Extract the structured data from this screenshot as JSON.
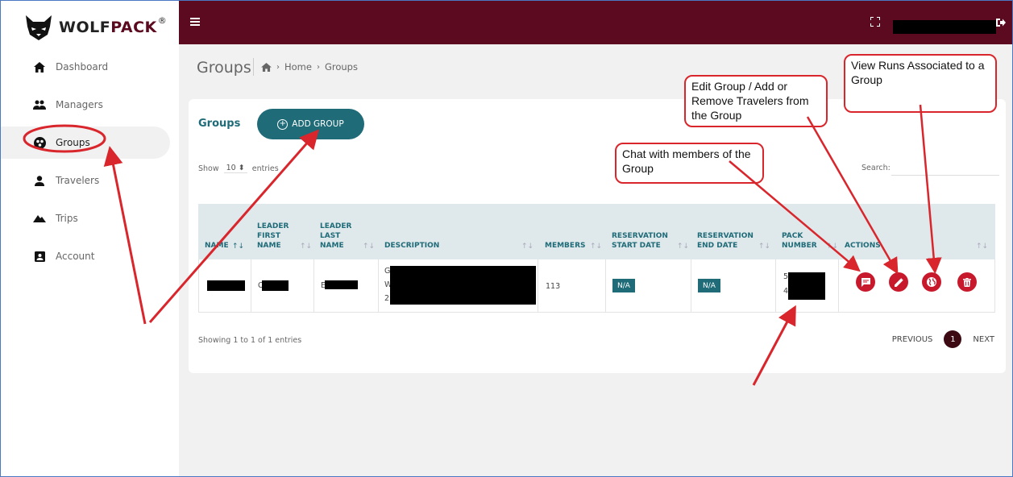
{
  "brand": {
    "name_part1": "WOLF",
    "name_part2": "PACK",
    "registered": "®"
  },
  "sidebar": {
    "items": [
      {
        "label": "Dashboard",
        "icon": "home-icon"
      },
      {
        "label": "Managers",
        "icon": "users-icon"
      },
      {
        "label": "Groups",
        "icon": "groups-icon",
        "active": true
      },
      {
        "label": "Travelers",
        "icon": "person-icon"
      },
      {
        "label": "Trips",
        "icon": "mountain-icon"
      },
      {
        "label": "Account",
        "icon": "account-card-icon"
      }
    ]
  },
  "topbar": {
    "background": "#5c0a1f",
    "icons": [
      "menu-icon",
      "fullscreen-icon",
      "logout-icon"
    ]
  },
  "page": {
    "title": "Groups",
    "breadcrumb": [
      "Home",
      "Groups"
    ]
  },
  "card": {
    "title": "Groups",
    "add_button": "ADD GROUP",
    "show_label": "Show",
    "entries_value": "10",
    "entries_label": "entries",
    "search_label": "Search:",
    "columns": [
      "NAME",
      "LEADER FIRST NAME",
      "LEADER LAST NAME",
      "DESCRIPTION",
      "MEMBERS",
      "RESERVATION START DATE",
      "RESERVATION END DATE",
      "PACK NUMBER",
      "ACTIONS"
    ],
    "row": {
      "leader_first_prefix": "C",
      "leader_last_prefix": "E",
      "description_prefix": [
        "G",
        "W",
        "2"
      ],
      "members": "113",
      "start_date": "N/A",
      "end_date": "N/A",
      "pack_prefix": [
        "5",
        "4"
      ],
      "actions": [
        "chat-icon",
        "edit-icon",
        "globe-icon",
        "delete-icon"
      ]
    },
    "footer": {
      "showing": "Showing 1 to 1 of 1 entries",
      "previous": "PREVIOUS",
      "page": "1",
      "next": "NEXT"
    }
  },
  "annotations": {
    "view_runs": "View Runs Associated to a Group",
    "edit_group": "Edit Group / Add or Remove Travelers from the Group",
    "chat": "Chat with members of the Group",
    "color": "#d9262c"
  }
}
